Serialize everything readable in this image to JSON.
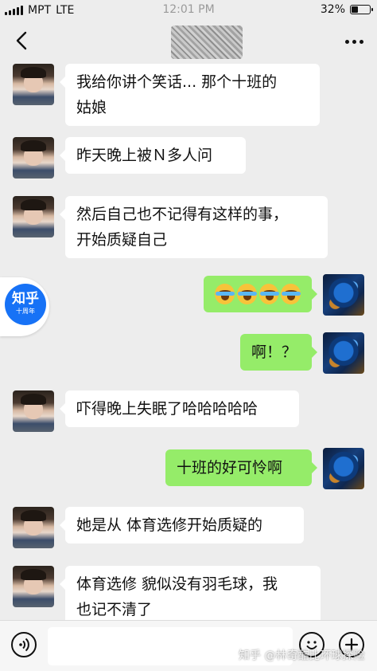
{
  "status_bar": {
    "carrier": "MPT",
    "network": "LTE",
    "time": "12:01 PM",
    "battery": "32%",
    "battery_level": 0.32
  },
  "nav": {
    "back_icon": "chevron-left-icon",
    "more_icon": "more-dots-icon"
  },
  "messages": [
    {
      "side": "left",
      "lines": [
        "我给你讲个笑话... 那个十班的",
        "姑娘"
      ]
    },
    {
      "side": "left",
      "lines": [
        "昨天晚上被Ｎ多人问"
      ]
    },
    {
      "side": "left",
      "lines": [
        "然后自己也不记得有这样的事，",
        "开始质疑自己"
      ]
    },
    {
      "side": "right",
      "emoji": [
        "crying-laughing-emoji",
        "crying-laughing-emoji",
        "crying-laughing-emoji",
        "crying-laughing-emoji"
      ]
    },
    {
      "side": "right",
      "lines": [
        "啊！？"
      ]
    },
    {
      "side": "left",
      "lines": [
        "吓得晚上失眠了哈哈哈哈哈"
      ]
    },
    {
      "side": "right",
      "lines": [
        "十班的好可怜啊"
      ]
    },
    {
      "side": "left",
      "lines": [
        "她是从 体育选修开始质疑的"
      ]
    },
    {
      "side": "left",
      "lines": [
        "体育选修 貌似没有羽毛球，我",
        "也记不清了"
      ]
    }
  ],
  "zhihu_badge": {
    "main": "知乎",
    "sub": "十周年"
  },
  "input_bar": {
    "voice_icon": "voice-icon",
    "emoji_icon": "emoji-icon",
    "plus_icon": "plus-icon",
    "value": ""
  },
  "watermark": "知乎 @林奇酷比环球探险",
  "colors": {
    "background": "#ededed",
    "sent_bubble": "#95ec69",
    "received_bubble": "#ffffff",
    "zhihu_blue": "#1772f6"
  }
}
